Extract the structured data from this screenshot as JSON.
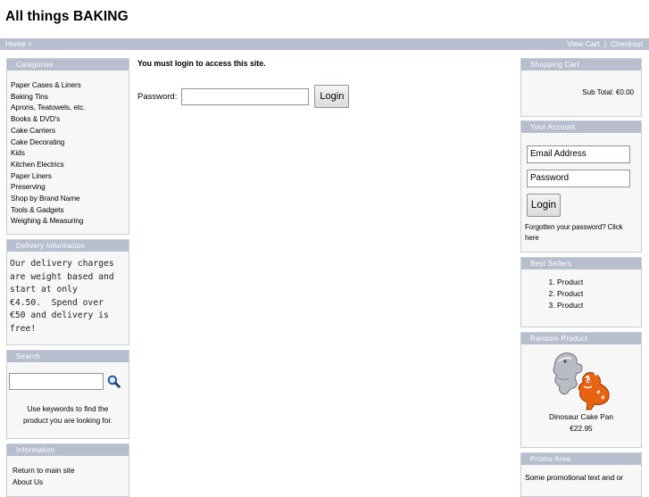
{
  "site": {
    "title": "All things BAKING"
  },
  "nav": {
    "breadcrumb": "Home >",
    "view_cart": "View Cart",
    "separator": "|",
    "checkout": "Checkout"
  },
  "categories": {
    "heading": "Categories",
    "items": [
      "Paper Cases & Liners",
      "Baking Tins",
      "Aprons, Teatowels, etc.",
      "Books & DVD's",
      "Cake Carriers",
      "Cake Decorating",
      "Kids",
      "Kitchen Electrics",
      "Paper Liners",
      "Preserving",
      "Shop by Brand Name",
      "Tools & Gadgets",
      "Weighing & Measuring"
    ]
  },
  "delivery": {
    "heading": "Delivery Information",
    "lines": [
      "Our delivery charges",
      "are weight based and",
      "start at only",
      "€4.50.  Spend over",
      "€50 and delivery is",
      "free!"
    ]
  },
  "search": {
    "heading": "Search",
    "value": "",
    "hint_line1": "Use keywords to find the",
    "hint_line2": "product you are looking for."
  },
  "information": {
    "heading": "Information",
    "links": [
      "Return to main site",
      "About Us"
    ]
  },
  "main": {
    "message": "You must login to access this site.",
    "password_label": "Password:",
    "password_value": "",
    "login_button": "Login"
  },
  "cart": {
    "heading": "Shopping Cart",
    "subtotal_label": "Sub Total:",
    "subtotal_value": "€0.00"
  },
  "account": {
    "heading": "Your Account",
    "email_placeholder": "Email Address",
    "password_placeholder": "Password",
    "login_button": "Login",
    "forgot_line1": "Forgotten your password? Click",
    "forgot_line2": "here"
  },
  "best_sellers": {
    "heading": "Best Sellers",
    "items": [
      "Product",
      "Product",
      "Product"
    ]
  },
  "random_product": {
    "heading": "Random Product",
    "name": "Dinosaur Cake Pan",
    "price": "€22.95"
  },
  "promo": {
    "heading": "Promo Area",
    "text": "Some promotional text and or"
  },
  "colors": {
    "header_bar": "#b7bfcf",
    "box_background": "#f7f7f7",
    "box_border": "#c9cdd6"
  },
  "icons": {
    "search": "magnifier-icon"
  }
}
